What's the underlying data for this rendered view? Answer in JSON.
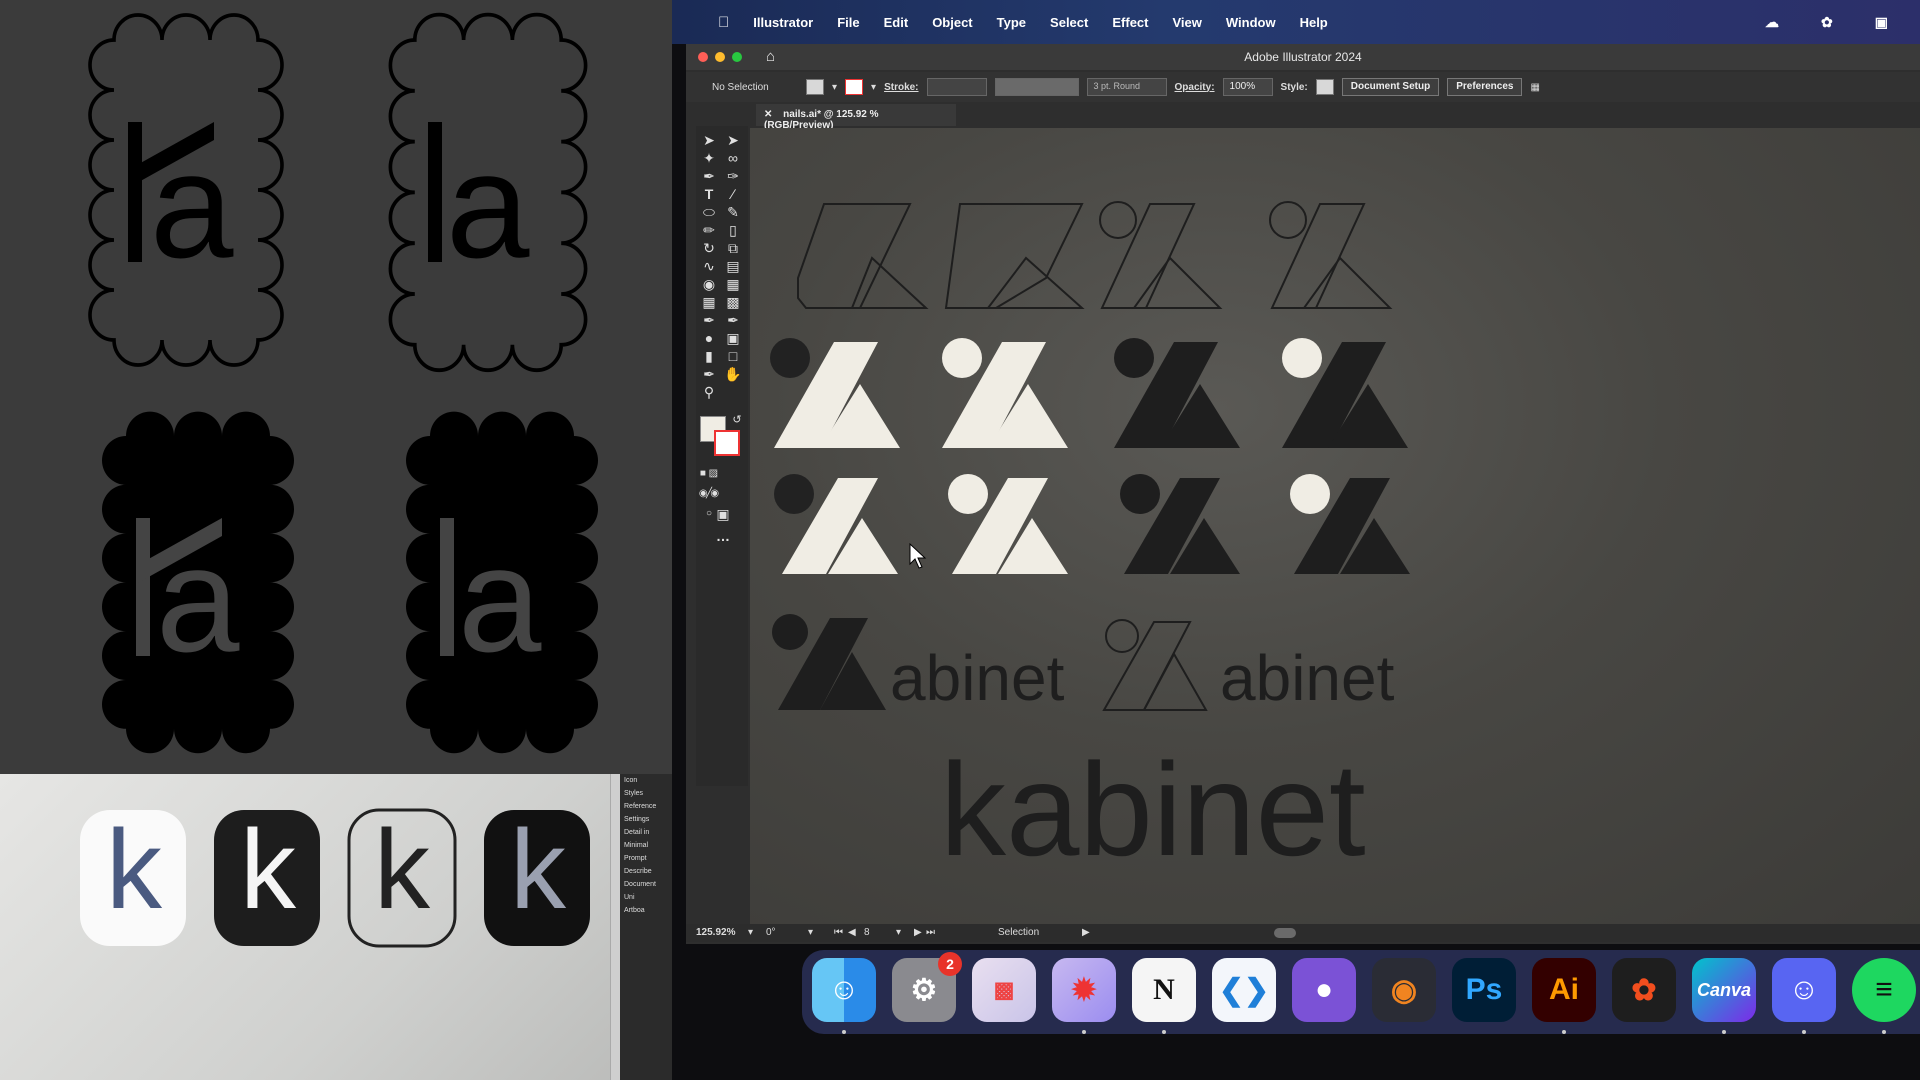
{
  "menubar": {
    "items": [
      "Illustrator",
      "File",
      "Edit",
      "Object",
      "Type",
      "Select",
      "Effect",
      "View",
      "Window",
      "Help"
    ]
  },
  "window": {
    "title": "Adobe Illustrator 2024"
  },
  "controlbar": {
    "selection": "No Selection",
    "stroke_label": "Stroke:",
    "brush": "3 pt. Round",
    "opacity_label": "Opacity:",
    "opacity_value": "100%",
    "style_label": "Style:",
    "document_setup": "Document Setup",
    "preferences": "Preferences"
  },
  "document": {
    "tab": "nails.ai* @ 125.92 % (RGB/Preview)"
  },
  "canvas": {
    "wordmark_1": "abinet",
    "wordmark_2": "abinet",
    "wordmark_big": "kabinet"
  },
  "statusbar": {
    "zoom": "125.92%",
    "rotation": "0°",
    "artboard": "8",
    "tool": "Selection"
  },
  "left": {
    "letter_a": "a",
    "photo_letter": "k",
    "sidebar": [
      "Icon",
      "Styles",
      "Reference",
      "Settings",
      "Detail in",
      "Minimal",
      "Prompt",
      "Describe",
      "Document",
      "Uni",
      "Artboa"
    ]
  },
  "dock": {
    "notification_count": "2",
    "ps_label": "Ps",
    "ai_label": "Ai",
    "canva_label": "Canva",
    "notion_label": "N"
  }
}
